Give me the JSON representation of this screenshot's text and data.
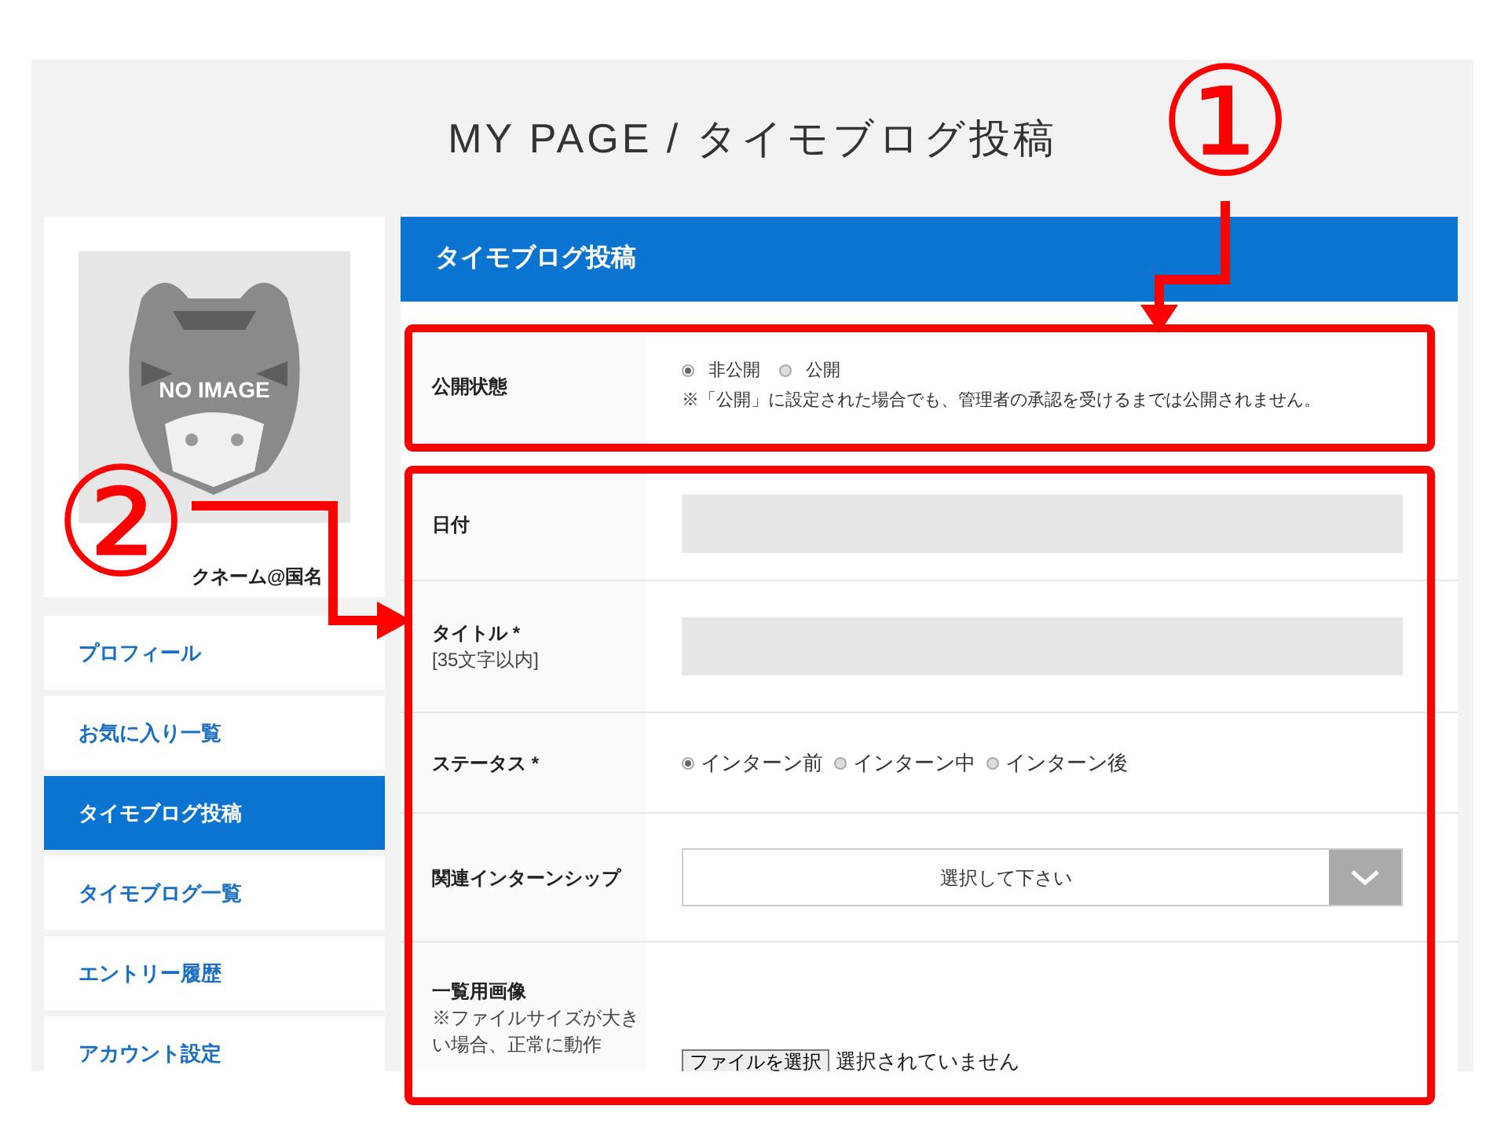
{
  "page_title": "MY PAGE / タイモブログ投稿",
  "profile": {
    "picture_caption": "NO IMAGE",
    "name": "クネーム@国名"
  },
  "sidebar": {
    "items": [
      {
        "label": "プロフィール",
        "selected": false
      },
      {
        "label": "お気に入り一覧",
        "selected": false
      },
      {
        "label": "タイモブログ投稿",
        "selected": true
      },
      {
        "label": "タイモブログ一覧",
        "selected": false
      },
      {
        "label": "エントリー履歴",
        "selected": false
      },
      {
        "label": "アカウント設定",
        "selected": false
      }
    ]
  },
  "form": {
    "heading": "タイモブログ投稿",
    "rows": [
      {
        "kind": "radio",
        "label": "公開状態",
        "options": [
          {
            "label": "非公開",
            "selected": true
          },
          {
            "label": "公開",
            "selected": false
          }
        ],
        "note": "※「公開」に設定された場合でも、管理者の承認を受けるまでは公開されません。"
      },
      {
        "kind": "text",
        "label": "日付"
      },
      {
        "kind": "text",
        "label": "タイトル *",
        "note_label": "[35文字以内]"
      },
      {
        "kind": "radio",
        "label": "ステータス *",
        "options": [
          {
            "label": "インターン前",
            "selected": true
          },
          {
            "label": "インターン中",
            "selected": false
          },
          {
            "label": "インターン後",
            "selected": false
          }
        ]
      },
      {
        "kind": "select",
        "label": "関連インターンシップ",
        "placeholder": "選択して下さい"
      },
      {
        "kind": "file",
        "label": "一覧用画像",
        "note_label": "※ファイルサイズが大きい場合、正常に動作",
        "button": "ファイルを選択",
        "status": "選択されていません"
      }
    ]
  },
  "annotations": [
    {
      "label": "①"
    },
    {
      "label": "②"
    }
  ]
}
